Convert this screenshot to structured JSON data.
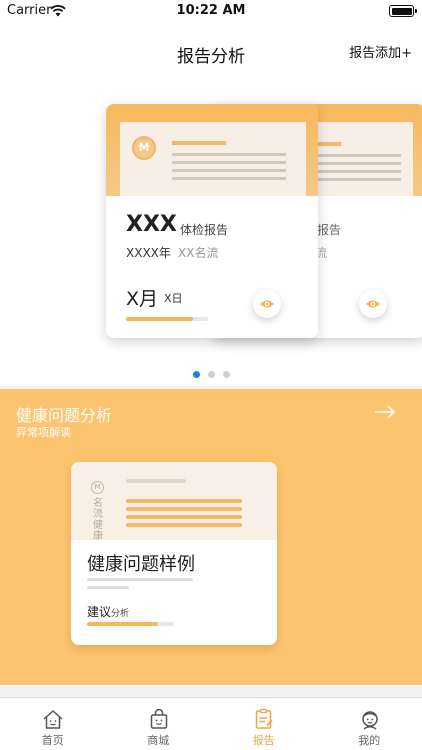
{
  "status_bar": {
    "carrier": "Carrier",
    "time": "10:22 AM"
  },
  "nav": {
    "title": "报告分析",
    "add_button": "报告添加+"
  },
  "carousel": {
    "cards": [
      {
        "title": "XXX",
        "subtitle": "体检报告",
        "year": "XXXX年",
        "org": "XX名流",
        "month": "X月",
        "day": "X日",
        "progress": 0.82
      },
      {
        "subtitle": "报告",
        "org": "流"
      }
    ],
    "dots": 3,
    "active_dot": 0,
    "logo_letter": "M"
  },
  "health_section": {
    "title": "健康问题分析",
    "subtitle": "异常项解读",
    "card": {
      "logo_letter": "M",
      "vertical_text": "名流健康",
      "title": "健康问题样例",
      "advice": "建议",
      "advice_suffix": "分析",
      "progress": 0.82
    }
  },
  "tabs": [
    {
      "label": "首页",
      "icon": "home-icon",
      "active": false
    },
    {
      "label": "商城",
      "icon": "shopping-bag-icon",
      "active": false
    },
    {
      "label": "报告",
      "icon": "report-icon",
      "active": true
    },
    {
      "label": "我的",
      "icon": "profile-icon",
      "active": false
    }
  ],
  "colors": {
    "accent": "#f5b65e",
    "section_bg": "#fdc46f",
    "active_tab": "#f3a33e",
    "active_dot": "#1a7ef0"
  }
}
